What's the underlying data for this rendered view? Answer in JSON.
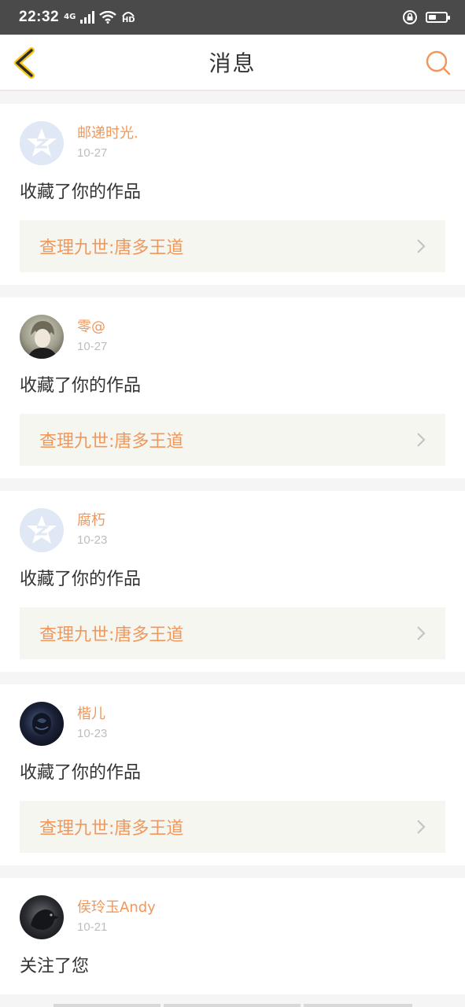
{
  "status": {
    "time": "22:32",
    "network": "4G",
    "hd": "HD"
  },
  "header": {
    "title": "消息",
    "back_icon": "chevron-left-icon",
    "search_icon": "search-icon",
    "accent": "#f0975b"
  },
  "messages": [
    {
      "name": "邮递时光.",
      "date": "10-27",
      "action": "收藏了你的作品",
      "work": "查理九世:唐多王道",
      "avatar": "qq-default"
    },
    {
      "name": "零@",
      "date": "10-27",
      "action": "收藏了你的作品",
      "work": "查理九世:唐多王道",
      "avatar": "anime-boy"
    },
    {
      "name": "腐朽",
      "date": "10-23",
      "action": "收藏了你的作品",
      "work": "查理九世:唐多王道",
      "avatar": "qq-default"
    },
    {
      "name": "楷儿",
      "date": "10-23",
      "action": "收藏了你的作品",
      "work": "查理九世:唐多王道",
      "avatar": "dark-rose"
    },
    {
      "name": "侯玲玉Andy",
      "date": "10-21",
      "action": "关注了您",
      "avatar": "crow"
    }
  ]
}
